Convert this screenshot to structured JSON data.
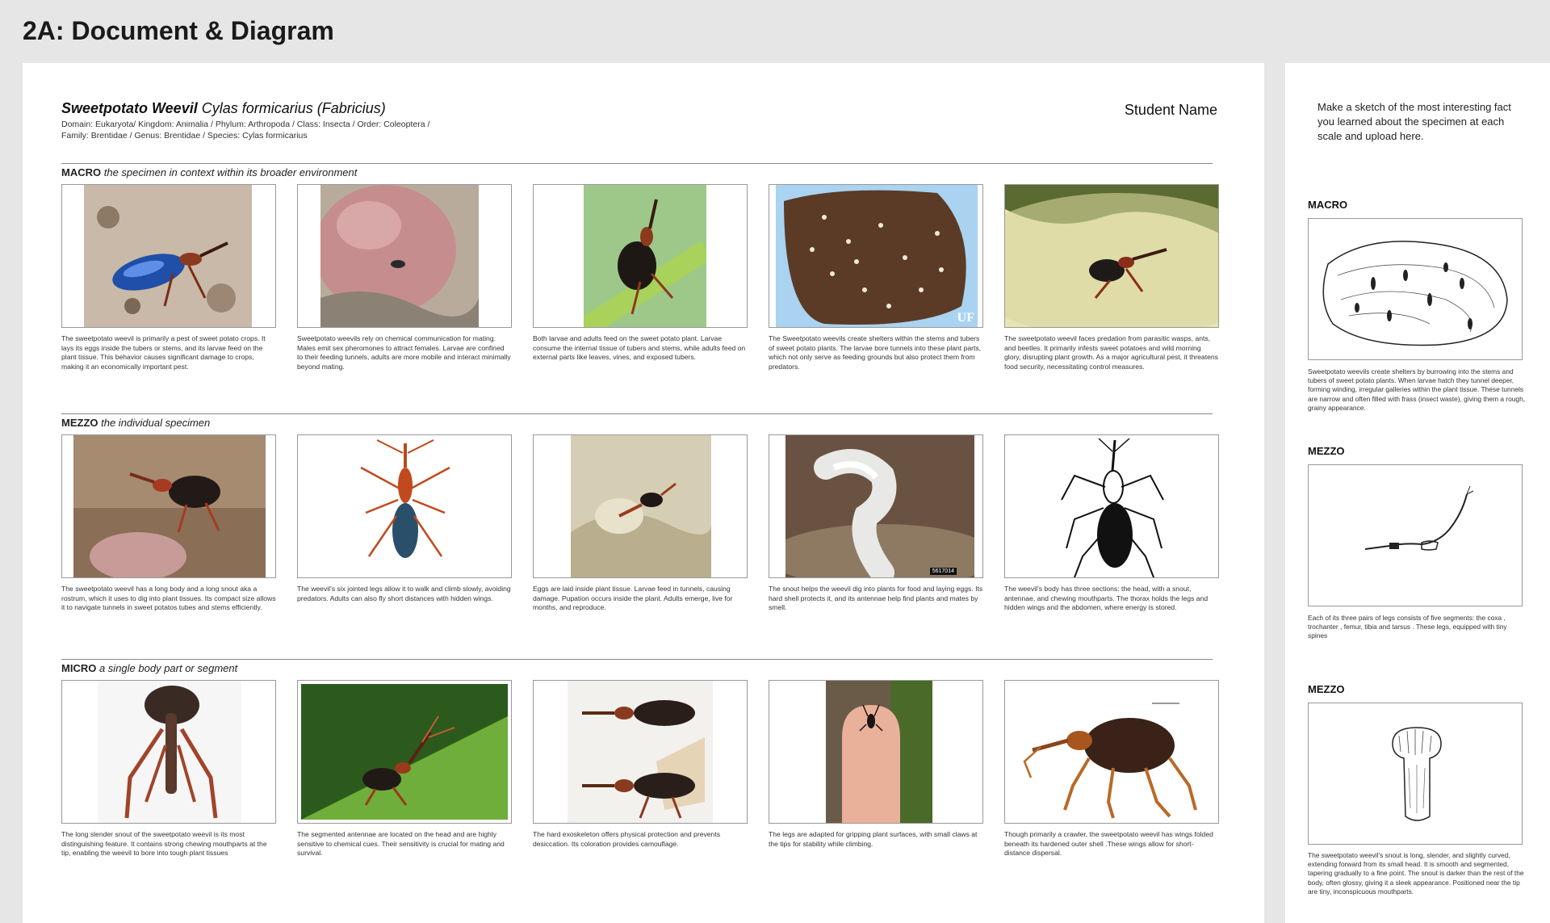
{
  "page_heading": "2A: Document & Diagram",
  "header": {
    "common_name": "Sweetpotato Weevil",
    "scientific_name": "Cylas formicarius (Fabricius)",
    "taxonomy_line1": "Domain: Eukaryota/ Kingdom: Animalia / Phylum: Arthropoda / Class: Insecta / Order: Coleoptera /",
    "taxonomy_line2": "Family: Brentidae / Genus: Brentidae / Species: Cylas formicarius",
    "student_name": "Student Name"
  },
  "sections": [
    {
      "label": "MACRO",
      "desc": "the specimen in context within its broader environment",
      "cards": [
        {
          "image": "blue-weevil-on-soil-photo",
          "caption": "The sweetpotato weevil is primarily a pest of sweet potato crops. It lays its eggs inside the tubers or stems, and its larvae feed on the plant tissue. This behavior causes significant damage to crops, making it an economically important pest."
        },
        {
          "image": "weevil-on-sweet-potato-photo",
          "caption": "Sweetpotato weevils rely on chemical communication for mating. Males emit sex pheromones to attract females. Larvae are confined to their feeding tunnels, adults are more mobile and interact minimally beyond mating."
        },
        {
          "image": "weevil-on-green-stem-photo",
          "caption": "Both larvae and adults feed on the sweet potato plant. Larvae consume the internal tissue of tubers and stems, while adults feed on external parts like leaves, vines, and exposed tubers."
        },
        {
          "image": "bored-tuber-cross-section-photo",
          "badge": "UF",
          "caption": "The Sweetpotato weevils create shelters within the stems and tubers of sweet potato plants. The larvae bore tunnels into these plant parts, which not only serve as feeding grounds but also protect them from predators."
        },
        {
          "image": "weevil-on-leaf-photo",
          "caption": "The sweetpotato weevil faces predation from parasitic wasps, ants, and beetles. It primarily infests sweet potatoes and wild morning glory, disrupting plant growth. As a major agricultural pest, it threatens food security, necessitating control measures."
        }
      ]
    },
    {
      "label": "MEZZO",
      "desc": "the individual specimen",
      "cards": [
        {
          "image": "weevil-on-dried-flower-photo",
          "caption": "The sweetpotato weevil has a long body and a long snout aka a rostrum, which it uses to dig into plant tissues. Its compact size allows it to navigate tunnels in sweet potatos tubes and stems efficiently."
        },
        {
          "image": "weevil-dorsal-view-photo",
          "caption": "The weevil's six jointed legs allow it to walk and climb slowly, avoiding predators. Adults can also fly short distances with hidden wings."
        },
        {
          "image": "weevil-in-plant-tissue-photo",
          "caption": "Eggs are laid inside plant tissue. Larvae feed in tunnels, causing damage. Pupation occurs inside the plant. Adults emerge, live for months, and reproduce."
        },
        {
          "image": "weevil-larva-photo",
          "badge": "5617014",
          "caption": "The snout helps the weevil dig into plants for food and laying eggs. Its hard shell protects it, and its antennae help find plants and mates by smell."
        },
        {
          "image": "weevil-line-drawing",
          "caption": "The weevil's body has three sections: the head, with a snout, antennae, and chewing mouthparts. The thorax holds the legs and hidden wings and the abdomen, where energy is stored."
        }
      ]
    },
    {
      "label": "MICRO",
      "desc": "a single body part or segment",
      "cards": [
        {
          "image": "weevil-snout-front-photo",
          "caption": "The long slender snout of the sweetpotato weevil is its most distinguishing feature. It contains strong chewing mouthparts at the tip, enabling the weevil to bore into tough plant tissues"
        },
        {
          "image": "weevil-antennae-on-leaf-photo",
          "caption": "The segmented antennae are located on the head and are highly sensitive to chemical cues. Their sensitivity is crucial for mating and survival."
        },
        {
          "image": "weevil-exoskeleton-specimens-photo",
          "caption": "The hard exoskeleton offers physical protection and prevents desiccation. Its coloration provides camouflage."
        },
        {
          "image": "weevil-on-fingertip-photo",
          "caption": "The legs are adapted for gripping plant surfaces, with small claws at the tips for stability while climbing."
        },
        {
          "image": "weevil-side-view-photo",
          "caption": "Though primarily a crawler, the sweetpotato weevil has wings folded beneath its hardened outer shell .These wings allow for short-distance dispersal."
        }
      ]
    }
  ],
  "sidebar": {
    "instruction": "Make a sketch of the most interesting fact you learned about the specimen at each scale and upload here.",
    "sketches": [
      {
        "label": "MACRO",
        "image": "tuber-tunnel-sketch",
        "caption": "Sweetpotato weevils create shelters by burrowing into the stems and tubers of sweet potato plants. When  larvae hatch they tunnel deeper, forming winding, irregular galleries within the plant tissue. These tunnels are narrow and often filled with frass (insect waste), giving them a rough, grainy appearance."
      },
      {
        "label": "MEZZO",
        "image": "weevil-leg-sketch",
        "caption": "Each of its three pairs of legs consists of five segments: the coxa , trochanter , femur, tibia and tarsus . These legs, equipped with tiny spines"
      },
      {
        "label": "MEZZO",
        "image": "weevil-snout-sketch",
        "caption": "The sweetpotato weevil's snout  is long, slender, and slightly curved, extending forward from its small head. It is smooth and segmented, tapering gradually to a fine point. The snout is darker than the rest of the body, often glossy, giving it a sleek appearance. Positioned near the tip are tiny, inconspicuous mouthparts."
      }
    ]
  }
}
